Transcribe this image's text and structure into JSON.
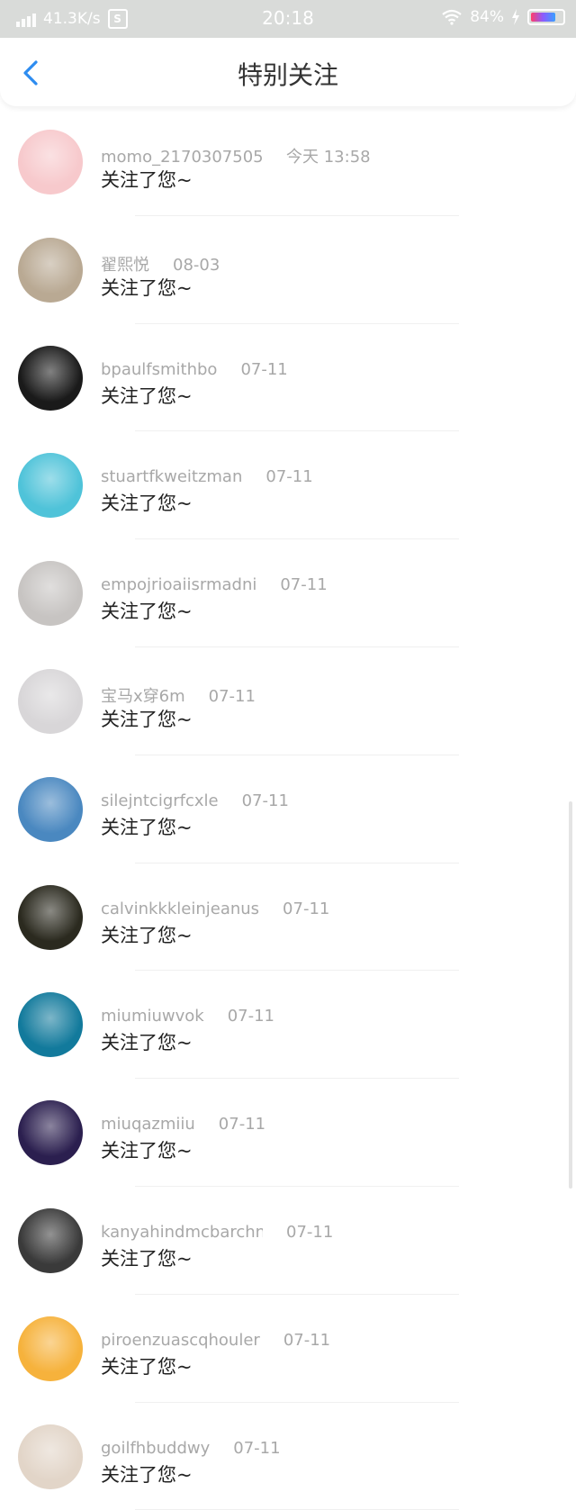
{
  "status_bar": {
    "speed": "41.3K/s",
    "s_icon_letter": "S",
    "time": "20:18",
    "battery": "84%",
    "icons": [
      "signal-icon",
      "s-app-icon",
      "wifi-icon",
      "charging-icon",
      "battery-icon"
    ]
  },
  "header": {
    "title": "特别关注",
    "back_icon": "chevron-left-icon"
  },
  "colors": {
    "accent": "#2d8cf0",
    "status_bar_bg": "#d9dbd9",
    "name_gray": "#a8a8a8",
    "message_text": "#222222"
  },
  "items": [
    {
      "name": "momo_21703075054···",
      "time": "今天 13:58",
      "message": "关注了您~",
      "avatar_bg": "#f7c9cc"
    },
    {
      "name": "翟熙悦",
      "time": "08-03",
      "message": "关注了您~",
      "avatar_bg": "#b9a993"
    },
    {
      "name": "bpaulfsmithbo",
      "time": "07-11",
      "message": "关注了您~",
      "avatar_bg": "#1a1a1a"
    },
    {
      "name": "stuartfkweitzman",
      "time": "07-11",
      "message": "关注了您~",
      "avatar_bg": "#4fc3d9"
    },
    {
      "name": "empojrioaiisrmadni",
      "time": "07-11",
      "message": "关注了您~",
      "avatar_bg": "#c7c4c2"
    },
    {
      "name": "宝马x穿6m",
      "time": "07-11",
      "message": "关注了您~",
      "avatar_bg": "#d8d6d8"
    },
    {
      "name": "silejntcigrfcxle",
      "time": "07-11",
      "message": "关注了您~",
      "avatar_bg": "#4a88c0"
    },
    {
      "name": "calvinkkkleinjeanus",
      "time": "07-11",
      "message": "关注了您~",
      "avatar_bg": "#2b2a1f"
    },
    {
      "name": "miumiuwvok",
      "time": "07-11",
      "message": "关注了您~",
      "avatar_bg": "#127a9c"
    },
    {
      "name": "miuqazmiiu",
      "time": "07-11",
      "message": "关注了您~",
      "avatar_bg": "#2b1f4f"
    },
    {
      "name": "kanyahindmcbarchn",
      "time": "07-11",
      "message": "关注了您~",
      "avatar_bg": "#3a3a3a"
    },
    {
      "name": "piroenzuascqhouler",
      "time": "07-11",
      "message": "关注了您~",
      "avatar_bg": "#f6b23c"
    },
    {
      "name": "goilfhbuddwy",
      "time": "07-11",
      "message": "关注了您~",
      "avatar_bg": "#e2d5c8"
    }
  ]
}
